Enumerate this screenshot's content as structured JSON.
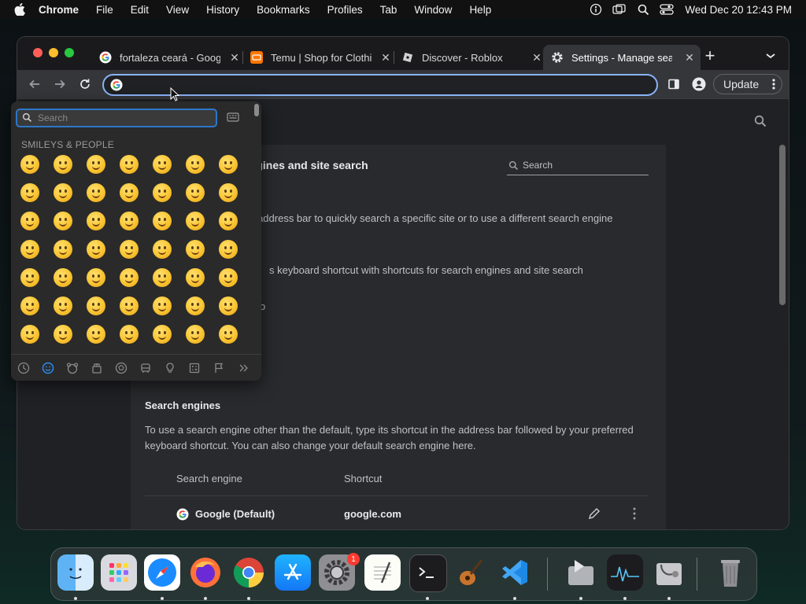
{
  "menubar": {
    "app_name": "Chrome",
    "menus": [
      "File",
      "Edit",
      "View",
      "History",
      "Bookmarks",
      "Profiles",
      "Tab",
      "Window",
      "Help"
    ],
    "clock": "Wed Dec 20  12:43 PM",
    "status_icons": [
      "accessibility-icon",
      "screen-mirroring-icon",
      "spotlight-search-icon",
      "control-center-icon"
    ]
  },
  "browser": {
    "tabs": [
      {
        "title": "fortaleza ceará - Google",
        "favicon": "google-icon",
        "active": false
      },
      {
        "title": "Temu | Shop for Clothing",
        "favicon": "temu-icon",
        "active": false
      },
      {
        "title": "Discover - Roblox",
        "favicon": "roblox-icon",
        "active": false
      },
      {
        "title": "Settings - Manage search",
        "favicon": "settings-icon",
        "active": true
      }
    ],
    "new_tab": "+",
    "update_label": "Update",
    "omnibox_value": ""
  },
  "settings": {
    "page_title": "engines and site search",
    "search_placeholder": "Search",
    "desc1": "he address bar to quickly search a specific site or to use a different search engine",
    "desc2": "s keyboard shortcut with shortcuts for search engines and site search",
    "fragment": "o",
    "section_title": "Search engines",
    "section_desc_line1": "To use a search engine other than the default, type its shortcut in the address bar followed by your preferred",
    "section_desc_line2": "keyboard shortcut. You can also change your default search engine here.",
    "col_engine": "Search engine",
    "col_shortcut": "Shortcut",
    "rows": [
      {
        "engine": "Google (Default)",
        "shortcut": "google.com"
      }
    ]
  },
  "emoji_picker": {
    "search_placeholder": "Search",
    "section_label": "SMILEYS & PEOPLE",
    "categories": [
      "recent-icon",
      "smiley-icon",
      "animal-icon",
      "food-icon",
      "activity-icon",
      "travel-icon",
      "objects-icon",
      "symbols-icon",
      "flags-icon",
      "more-icon"
    ],
    "rows": [
      [
        "😀",
        "😃",
        "😄",
        "😁",
        "😆",
        "🥹",
        "😅"
      ],
      [
        "😂",
        "🤣",
        "🥲",
        "☺️",
        "😊",
        "😇",
        "🙂"
      ],
      [
        "🙃",
        "😉",
        "😌",
        "😍",
        "🥰",
        "😘",
        "😗"
      ],
      [
        "😙",
        "😚",
        "😋",
        "😛",
        "😝",
        "😜",
        "🤪"
      ],
      [
        "🤨",
        "🧐",
        "🤓",
        "😎",
        "🥸",
        "🤩",
        "🥳"
      ],
      [
        "😏",
        "😒",
        "😞",
        "😔",
        "😟",
        "😕",
        "🙁"
      ],
      [
        "☹️",
        "😣",
        "😖",
        "😫",
        "😩",
        "🥺",
        "😢"
      ]
    ]
  },
  "dock": {
    "apps": [
      "Finder",
      "Launchpad",
      "Safari",
      "Firefox",
      "Google Chrome",
      "App Store",
      "System Settings",
      "TextEdit",
      "Terminal",
      "GarageBand",
      "Visual Studio Code",
      "Migration Assistant",
      "Activity Monitor",
      "Disk Utility",
      "Trash"
    ],
    "settings_badge": "1"
  }
}
